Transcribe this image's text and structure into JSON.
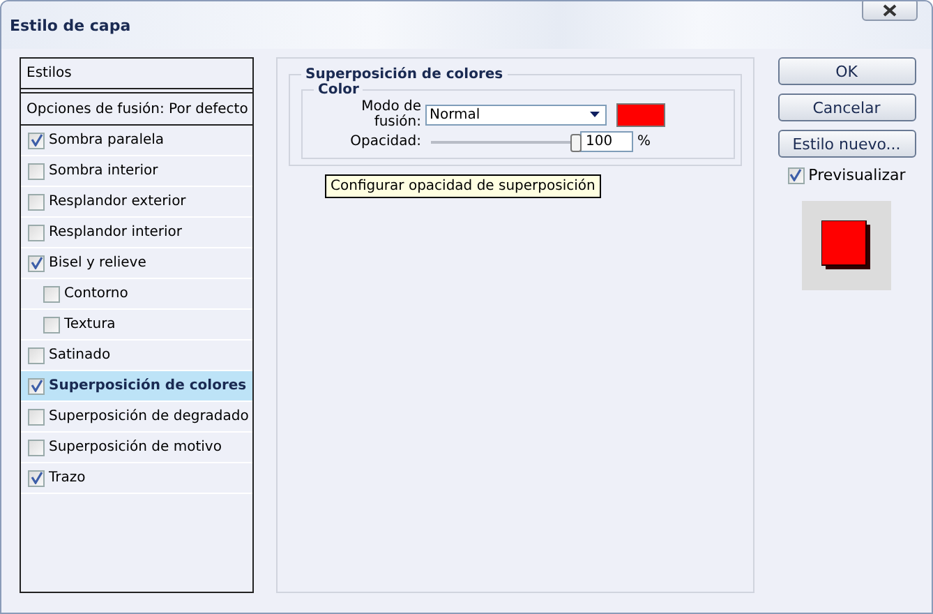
{
  "window": {
    "title": "Estilo de capa"
  },
  "styles_panel": {
    "header": "Estilos",
    "blend_options": "Opciones de fusión: Por defecto",
    "items": [
      {
        "label": "Sombra paralela",
        "checked": true,
        "selected": false
      },
      {
        "label": "Sombra interior",
        "checked": false,
        "selected": false
      },
      {
        "label": "Resplandor exterior",
        "checked": false,
        "selected": false
      },
      {
        "label": "Resplandor interior",
        "checked": false,
        "selected": false
      },
      {
        "label": "Bisel y relieve",
        "checked": true,
        "selected": false,
        "children": [
          {
            "label": "Contorno",
            "checked": false,
            "selected": false
          },
          {
            "label": "Textura",
            "checked": false,
            "selected": false
          }
        ]
      },
      {
        "label": "Satinado",
        "checked": false,
        "selected": false
      },
      {
        "label": "Superposición de colores",
        "checked": true,
        "selected": true
      },
      {
        "label": "Superposición de degradado",
        "checked": false,
        "selected": false
      },
      {
        "label": "Superposición de motivo",
        "checked": false,
        "selected": false
      },
      {
        "label": "Trazo",
        "checked": true,
        "selected": false
      }
    ]
  },
  "settings": {
    "title": "Superposición de colores",
    "group": "Color",
    "blend_mode_label": "Modo de fusión:",
    "blend_mode": "Normal",
    "color": "#ff0000",
    "opacity_label": "Opacidad:",
    "opacity": {
      "level": 1
    },
    "opacity_value": "100",
    "opacity_unit": "%",
    "tooltip": "Configurar opacidad de superposición"
  },
  "buttons": [
    "OK",
    "Cancelar",
    "Estilo nuevo..."
  ],
  "preview": {
    "label": "Previsualizar",
    "checked": true
  }
}
